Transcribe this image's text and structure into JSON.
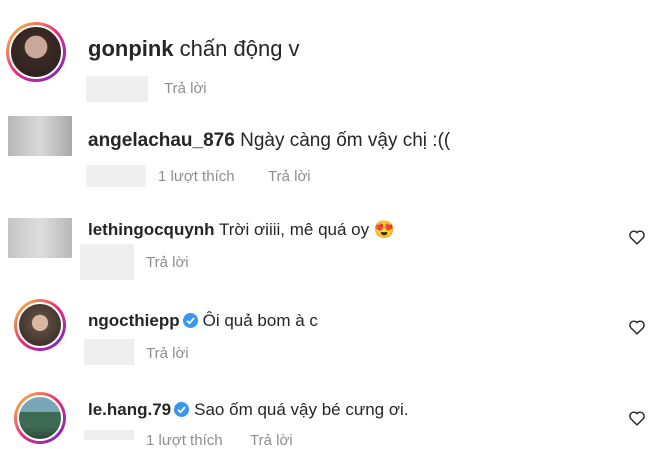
{
  "comments": [
    {
      "username": "gonpink",
      "text": "chấn động v",
      "reply_label": "Trả lời",
      "likes": ""
    },
    {
      "username": "angelachau_876",
      "text": "Ngày càng ốm vậy chị :((",
      "reply_label": "Trả lời",
      "likes": "1 lượt thích"
    },
    {
      "username": "lethingocquynh",
      "text": "Trời ơiiii, mê quá oy 😍",
      "reply_label": "Trả lời",
      "likes": ""
    },
    {
      "username": "ngocthiepp",
      "text": "Ôi quả bom à c",
      "reply_label": "Trả lời",
      "likes": ""
    },
    {
      "username": "le.hang.79",
      "text": "Sao ốm quá vậy bé cưng ơi.",
      "reply_label": "Trả lời",
      "likes": "1 lượt thích"
    }
  ],
  "icons": {
    "like": "heart-outline-icon",
    "verified": "verified-badge-icon"
  },
  "colors": {
    "verified": "#3797f0",
    "meta": "#8e8e8e",
    "ring_start": "#f9ce34",
    "ring_end": "#6228d7"
  }
}
